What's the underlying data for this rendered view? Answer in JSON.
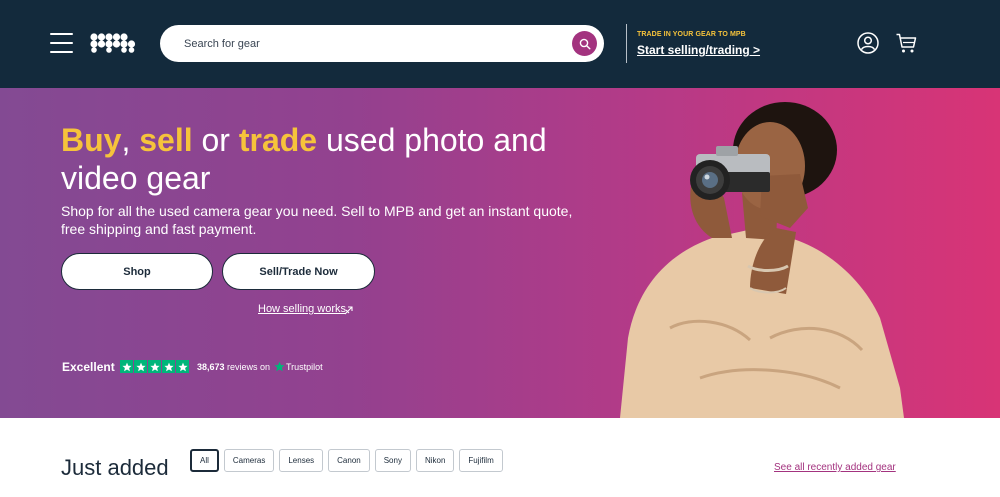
{
  "colors": {
    "header_bg": "#132a3c",
    "accent_yellow": "#f6c33b",
    "accent_magenta": "#a3337f",
    "trustpilot_green": "#00b67a"
  },
  "header": {
    "logo_name": "mpb-logo",
    "search": {
      "placeholder": "Search for gear"
    },
    "trade_small": "TRADE IN YOUR GEAR TO MPB",
    "trade_link": "Start selling/trading >",
    "icons": [
      "menu-icon",
      "search-icon",
      "account-icon",
      "cart-icon"
    ]
  },
  "hero": {
    "title": {
      "part1": "Buy",
      "sep1": ", ",
      "part2": "sell",
      "sep2": " or ",
      "part3": "trade",
      "rest": " used photo and video gear"
    },
    "subtitle": "Shop for all the used camera gear you need. Sell to MPB and get an instant quote, free shipping and fast payment.",
    "shop_button": "Shop",
    "sell_button": "Sell/Trade Now",
    "how_link": "How selling works",
    "trustpilot": {
      "rating_word": "Excellent",
      "stars": 5,
      "review_count": "38,673",
      "reviews_suffix": "reviews on",
      "brand": "Trustpilot"
    }
  },
  "just_added": {
    "title": "Just added",
    "filters": [
      "All",
      "Cameras",
      "Lenses",
      "Canon",
      "Sony",
      "Nikon",
      "Fujifilm"
    ],
    "active_filter": "All",
    "see_all": "See all recently added gear"
  }
}
